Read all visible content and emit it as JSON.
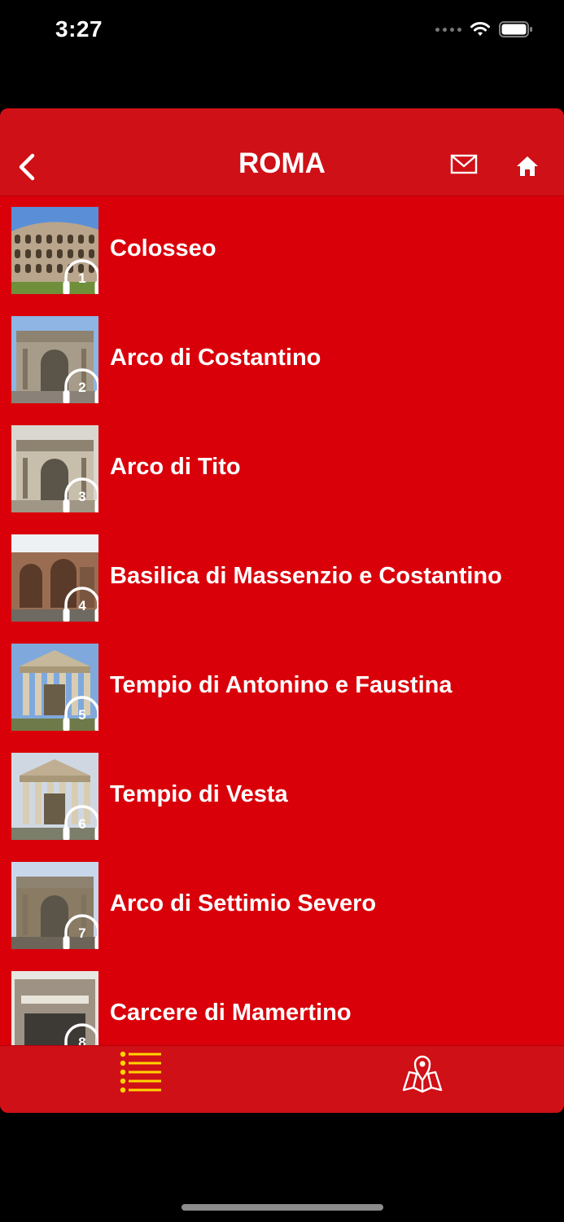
{
  "status_bar": {
    "time": "3:27"
  },
  "nav": {
    "title": "ROMA",
    "back_icon": "chevron-left-icon",
    "mail_icon": "mail-icon",
    "home_icon": "home-icon"
  },
  "colors": {
    "primary": "#d9000a",
    "bar": "#cf1016",
    "active_tab": "#ffd400"
  },
  "list": [
    {
      "label": "Colosseo",
      "number": "1"
    },
    {
      "label": "Arco di Costantino",
      "number": "2"
    },
    {
      "label": "Arco di Tito",
      "number": "3"
    },
    {
      "label": "Basilica di Massenzio e Costantino",
      "number": "4"
    },
    {
      "label": "Tempio di Antonino e Faustina",
      "number": "5"
    },
    {
      "label": "Tempio di Vesta",
      "number": "6"
    },
    {
      "label": "Arco di Settimio Severo",
      "number": "7"
    },
    {
      "label": "Carcere di Mamertino",
      "number": "8"
    }
  ],
  "tabs": [
    {
      "icon": "list-icon",
      "active": true
    },
    {
      "icon": "map-pin-icon",
      "active": false
    }
  ]
}
